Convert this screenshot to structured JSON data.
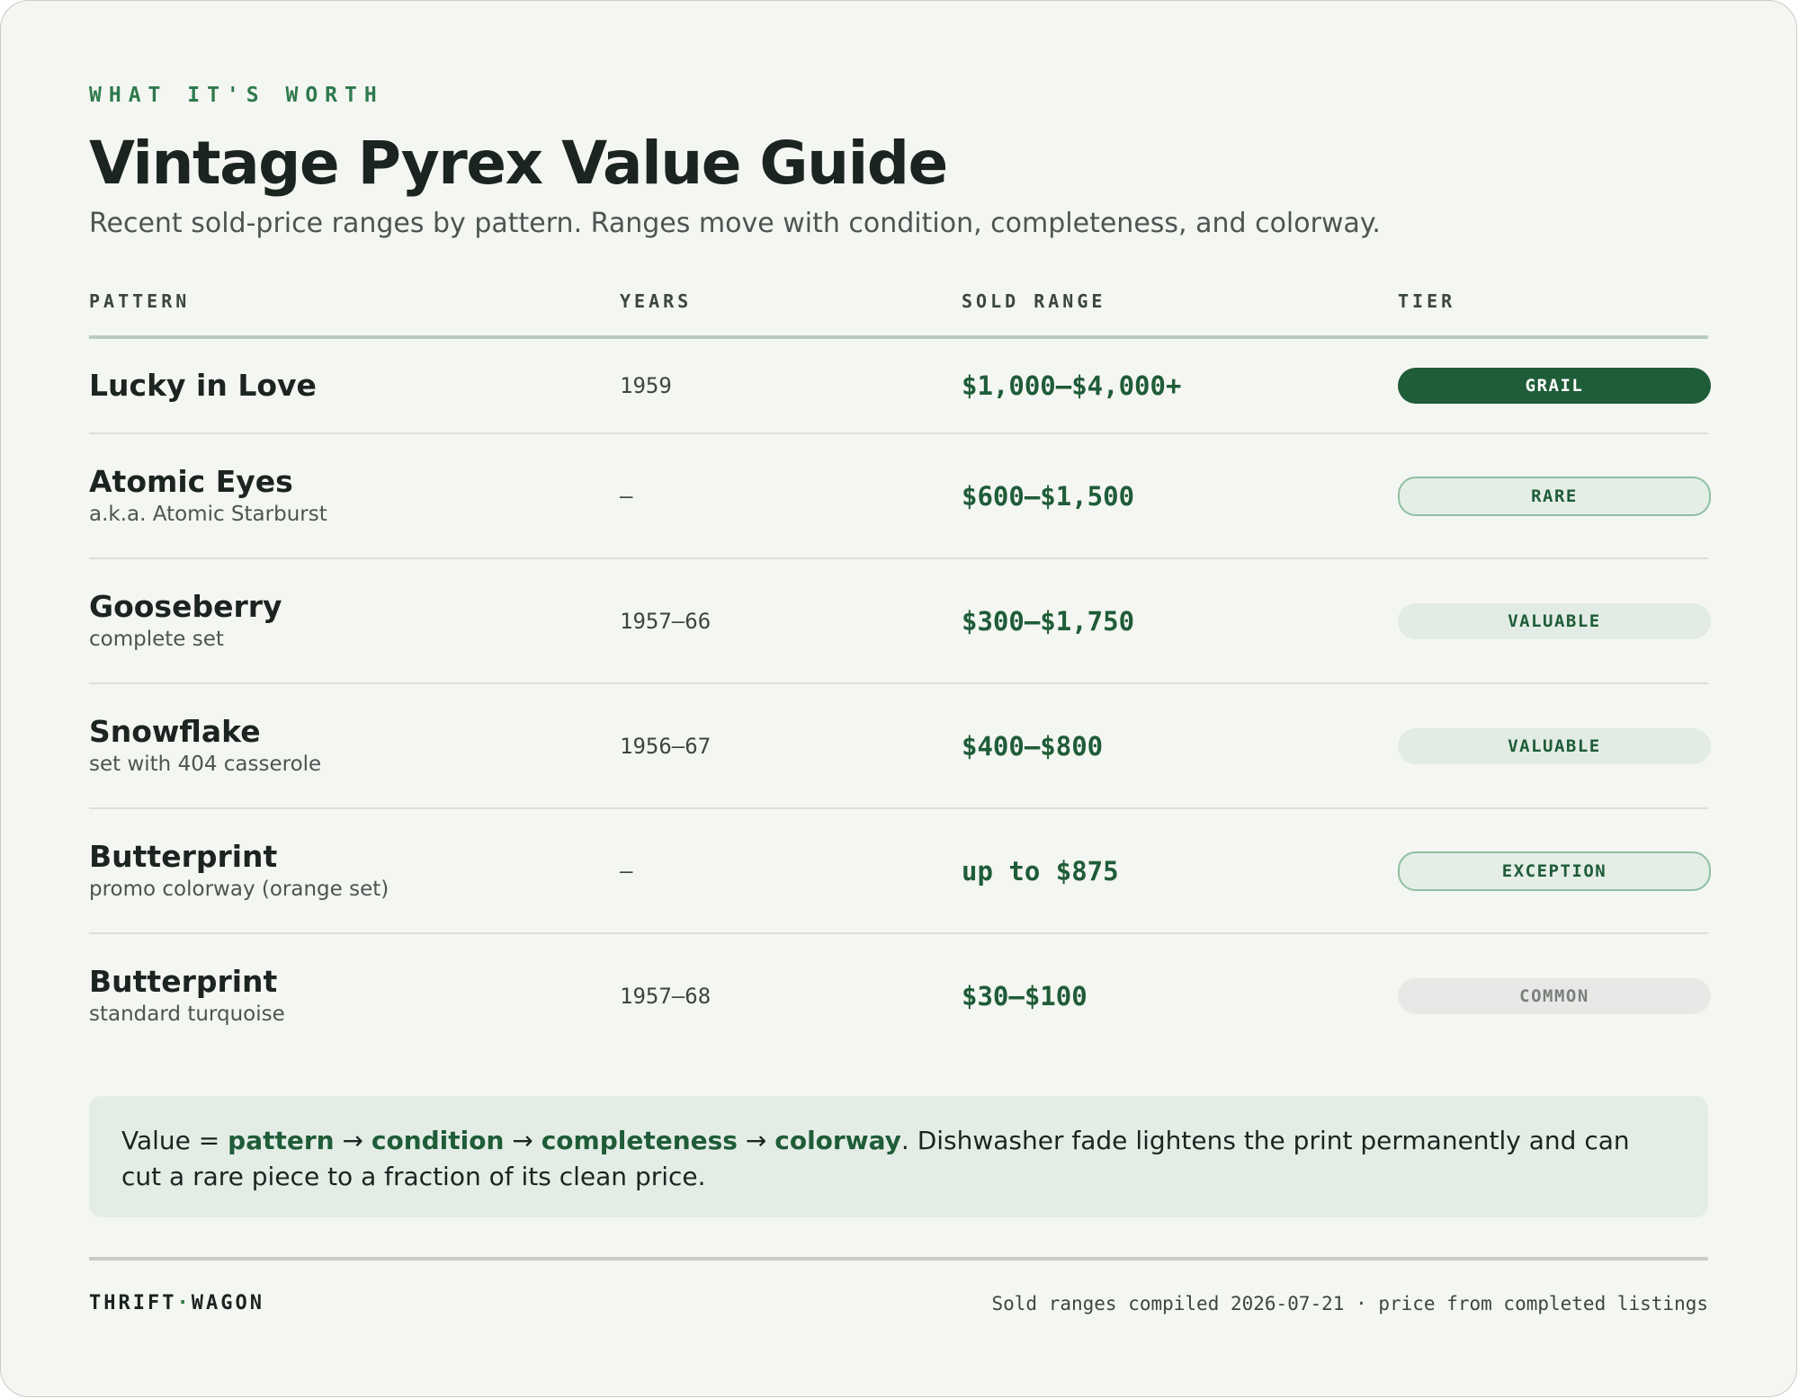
{
  "header": {
    "eyebrow": "WHAT IT'S WORTH",
    "title": "Vintage Pyrex Value Guide",
    "subtitle": "Recent sold-price ranges by pattern. Ranges move with condition, completeness, and colorway."
  },
  "table": {
    "columns": [
      "PATTERN",
      "YEARS",
      "SOLD RANGE",
      "TIER"
    ],
    "rows": [
      {
        "name": "Lucky in Love",
        "note": "",
        "years": "1959",
        "range": "$1,000–$4,000+",
        "tier": "GRAIL"
      },
      {
        "name": "Atomic Eyes",
        "note": "a.k.a. Atomic Starburst",
        "years": "—",
        "range": "$600–$1,500",
        "tier": "RARE"
      },
      {
        "name": "Gooseberry",
        "note": "complete set",
        "years": "1957–66",
        "range": "$300–$1,750",
        "tier": "VALUABLE"
      },
      {
        "name": "Snowflake",
        "note": "set with 404 casserole",
        "years": "1956–67",
        "range": "$400–$800",
        "tier": "VALUABLE"
      },
      {
        "name": "Butterprint",
        "note": "promo colorway (orange set)",
        "years": "—",
        "range": "up to $875",
        "tier": "EXCEPTION"
      },
      {
        "name": "Butterprint",
        "note": "standard turquoise",
        "years": "1957–68",
        "range": "$30–$100",
        "tier": "COMMON"
      }
    ]
  },
  "note": {
    "prefix": "Value = ",
    "k1": "pattern",
    "arrow": " → ",
    "k2": "condition",
    "k3": "completeness",
    "k4": "colorway",
    "rest": ". Dishwasher fade lightens the print permanently and can cut a rare piece to a fraction of its clean price."
  },
  "footer": {
    "brand_left": "THRIFT",
    "brand_dot": "·",
    "brand_right": "WAGON",
    "compiled": "Sold ranges compiled 2026-07-21 · price from completed listings"
  },
  "colors": {
    "accent": "#1f5c38",
    "eyebrow": "#2e7a4c",
    "background": "#f4f6f2",
    "note_bg": "#e3ede6"
  }
}
